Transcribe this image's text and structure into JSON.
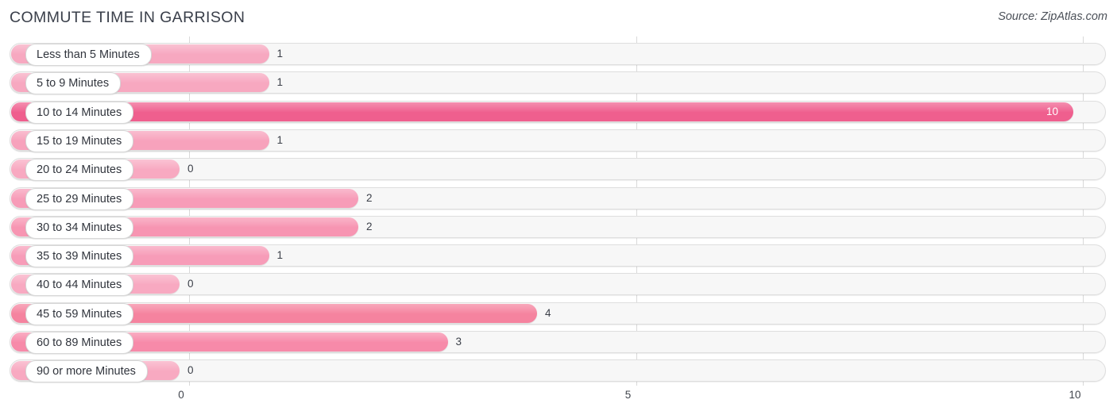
{
  "header": {
    "title": "COMMUTE TIME IN GARRISON",
    "source": "Source: ZipAtlas.com"
  },
  "colors": {
    "bar_light": "#f7a8c0",
    "bar_mid": "#f789ab",
    "bar_strong": "#ef5f8e",
    "track_fill": "#f7f7f7",
    "track_border": "#dedede",
    "gridline": "#d9d9d9",
    "title_text": "#3a3f4a",
    "value_text": "#3c4049",
    "value_text_inside": "#ffffff"
  },
  "chart_data": {
    "type": "bar",
    "orientation": "horizontal",
    "title": "COMMUTE TIME IN GARRISON",
    "xlabel": "",
    "ylabel": "",
    "xlim": [
      0,
      10
    ],
    "grid": true,
    "legend": null,
    "xticks": [
      "0",
      "5",
      "10"
    ],
    "xtick_values": [
      0,
      5,
      10
    ],
    "categories": [
      "Less than 5 Minutes",
      "5 to 9 Minutes",
      "10 to 14 Minutes",
      "15 to 19 Minutes",
      "20 to 24 Minutes",
      "25 to 29 Minutes",
      "30 to 34 Minutes",
      "35 to 39 Minutes",
      "40 to 44 Minutes",
      "45 to 59 Minutes",
      "60 to 89 Minutes",
      "90 or more Minutes"
    ],
    "values": [
      1,
      1,
      10,
      1,
      0,
      2,
      2,
      1,
      0,
      4,
      3,
      0
    ],
    "value_labels": [
      "1",
      "1",
      "10",
      "1",
      "0",
      "2",
      "2",
      "1",
      "0",
      "4",
      "3",
      "0"
    ]
  },
  "rows": [
    {
      "label": "Less than 5 Minutes",
      "value": 1,
      "value_label": "1",
      "color": "#f7a8c0",
      "inside": false
    },
    {
      "label": "5 to 9 Minutes",
      "value": 1,
      "value_label": "1",
      "color": "#f7a8c0",
      "inside": false
    },
    {
      "label": "10 to 14 Minutes",
      "value": 10,
      "value_label": "10",
      "color": "#ef5f8e",
      "inside": true
    },
    {
      "label": "15 to 19 Minutes",
      "value": 1,
      "value_label": "1",
      "color": "#f7a2bc",
      "inside": false
    },
    {
      "label": "20 to 24 Minutes",
      "value": 0,
      "value_label": "0",
      "color": "#f8a9c1",
      "inside": false
    },
    {
      "label": "25 to 29 Minutes",
      "value": 2,
      "value_label": "2",
      "color": "#f79cb8",
      "inside": false
    },
    {
      "label": "30 to 34 Minutes",
      "value": 2,
      "value_label": "2",
      "color": "#f795b2",
      "inside": false
    },
    {
      "label": "35 to 39 Minutes",
      "value": 1,
      "value_label": "1",
      "color": "#f79cb8",
      "inside": false
    },
    {
      "label": "40 to 44 Minutes",
      "value": 0,
      "value_label": "0",
      "color": "#f8a9c1",
      "inside": false
    },
    {
      "label": "45 to 59 Minutes",
      "value": 4,
      "value_label": "4",
      "color": "#f5839f",
      "inside": false
    },
    {
      "label": "60 to 89 Minutes",
      "value": 3,
      "value_label": "3",
      "color": "#f78aa9",
      "inside": false
    },
    {
      "label": "90 or more Minutes",
      "value": 0,
      "value_label": "0",
      "color": "#f8a9c1",
      "inside": false
    }
  ]
}
